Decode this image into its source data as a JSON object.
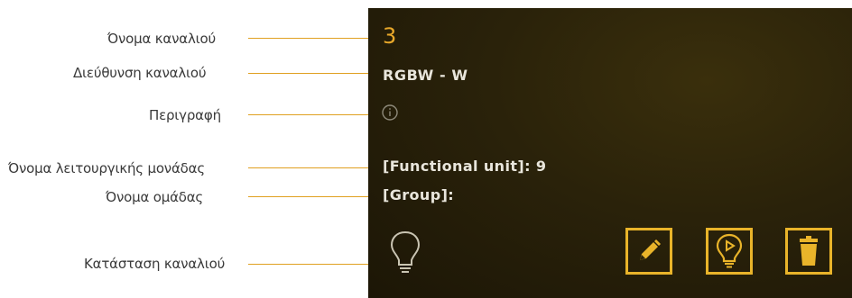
{
  "annotations": {
    "channel_name": "Όνομα καναλιού",
    "channel_address": "Διεύθυνση καναλιού",
    "description": "Περιγραφή",
    "functional_unit_name": "Όνομα λειτουργικής μονάδας",
    "group_name": "Όνομα ομάδας",
    "channel_status": "Κατάσταση καναλιού"
  },
  "card": {
    "channel_number": "3",
    "channel_address": "RGBW - W",
    "functional_unit": "[Functional unit]: 9",
    "group": "[Group]:"
  },
  "icons": {
    "description": "info-icon",
    "status": "light-bulb-icon",
    "edit": "pencil-icon",
    "play": "bulb-play-icon",
    "delete": "trash-icon"
  },
  "colors": {
    "accent": "#e9b42a",
    "channel_number": "#e8a82a",
    "card_background": "#2a220a",
    "leader_line": "#e0a020"
  }
}
